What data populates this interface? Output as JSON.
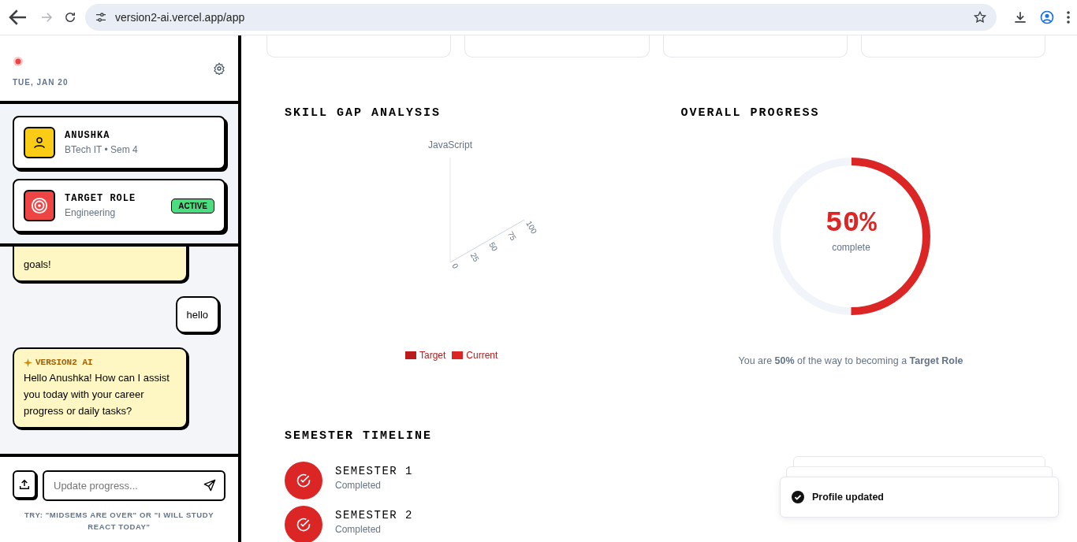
{
  "browser": {
    "url": "version2-ai.vercel.app/app",
    "forward_disabled": true
  },
  "sidebar": {
    "date": "TUE, JAN 20",
    "profile": {
      "name": "ANUSHKA",
      "subtitle": "BTech IT • Sem 4"
    },
    "target": {
      "label": "TARGET ROLE",
      "value": "Engineering",
      "badge": "ACTIVE"
    },
    "messages": [
      {
        "kind": "ai",
        "text": "goals!"
      },
      {
        "kind": "user",
        "text": "hello"
      },
      {
        "kind": "ai",
        "sender": "VERSION2 AI",
        "text": "Hello Anushka! How can I assist you today with your career progress or daily tasks?"
      }
    ],
    "input": {
      "placeholder": "Update progress..."
    },
    "hint": "TRY: \"MIDSEMS ARE OVER\" OR \"I WILL STUDY REACT TODAY\""
  },
  "top_cards": [
    {
      "kind": "stat"
    },
    {
      "kind": "stat"
    },
    {
      "kind": "stat"
    },
    {
      "kind": "stat"
    }
  ],
  "skill_gap": {
    "title": "SKILL GAP ANALYSIS",
    "axis_label": "JavaScript",
    "ticks": [
      "0",
      "25",
      "50",
      "75",
      "100"
    ],
    "legend": [
      {
        "label": "Target",
        "color": "#b91c1c"
      },
      {
        "label": "Current",
        "color": "#dc2626"
      }
    ]
  },
  "progress": {
    "title": "OVERALL PROGRESS",
    "level": 0.5,
    "percent": "50%",
    "sublabel": "complete",
    "caption": "You are **50%** of the way to becoming a **Target Role**"
  },
  "timeline": {
    "title": "SEMESTER TIMELINE",
    "items": [
      {
        "label": "SEMESTER 1",
        "status": "Completed",
        "completed": true
      },
      {
        "label": "SEMESTER 2",
        "status": "Completed",
        "completed": true
      }
    ]
  },
  "toast": {
    "text": "Profile updated"
  }
}
